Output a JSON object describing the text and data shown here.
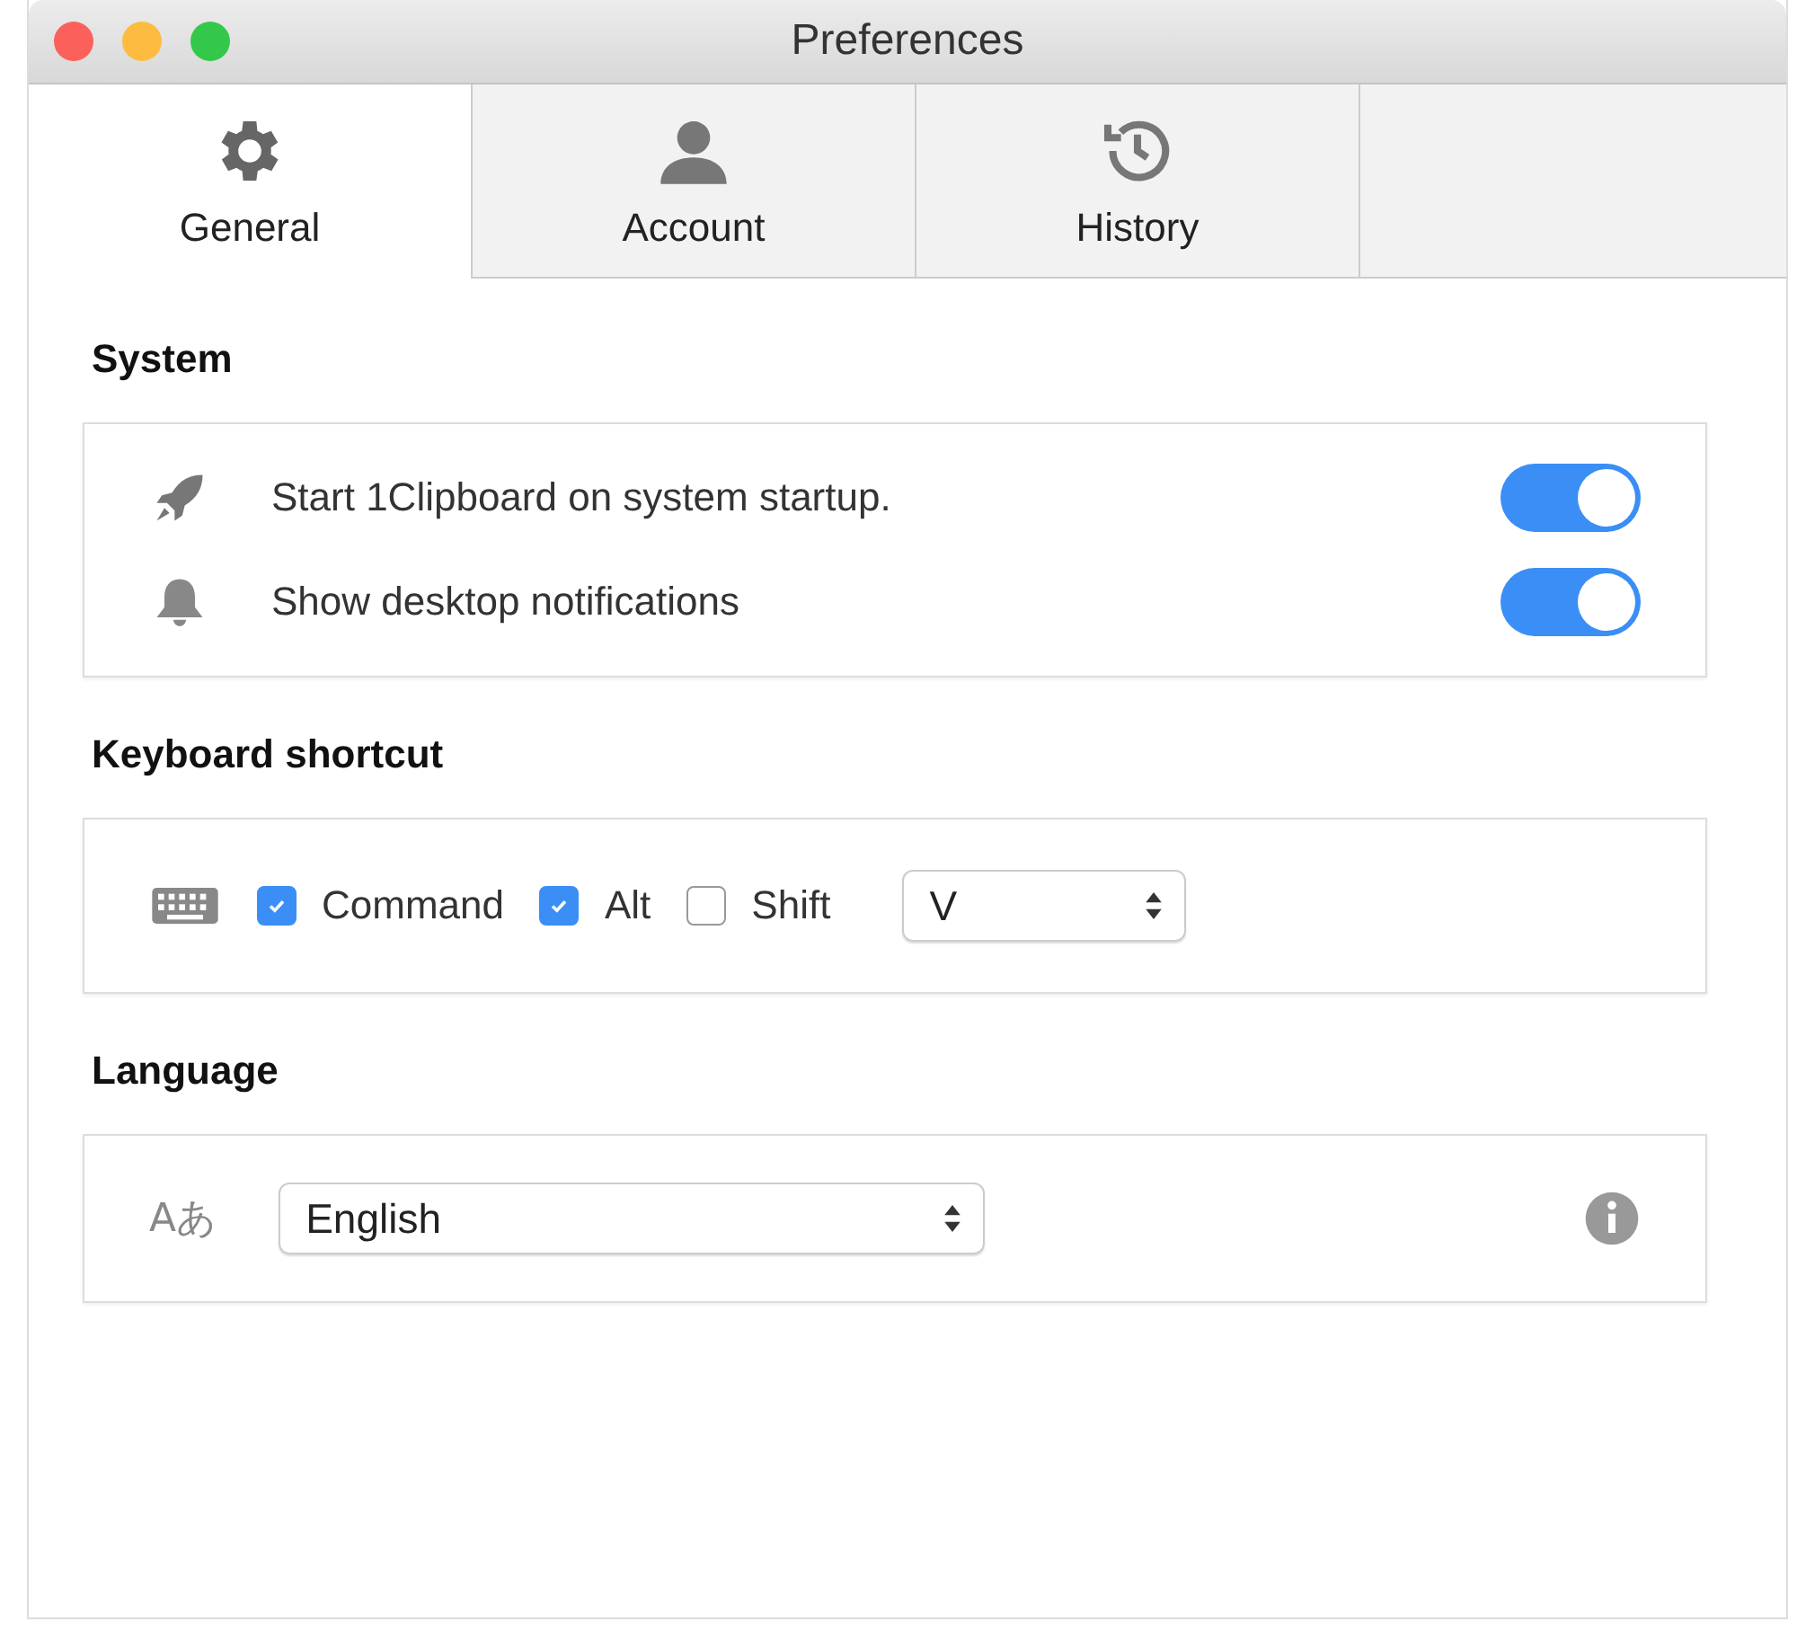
{
  "window": {
    "title": "Preferences"
  },
  "tabs": [
    {
      "label": "General",
      "kind": "gear",
      "selected": true
    },
    {
      "label": "Account",
      "kind": "person",
      "selected": false
    },
    {
      "label": "History",
      "kind": "history",
      "selected": false
    }
  ],
  "system": {
    "heading": "System",
    "rows": [
      {
        "label": "Start 1Clipboard on system startup.",
        "kind": "rocket",
        "on": true
      },
      {
        "label": "Show desktop notifications",
        "kind": "bell",
        "on": true
      }
    ]
  },
  "keyboard": {
    "heading": "Keyboard shortcut",
    "modifiers": [
      {
        "label": "Command",
        "checked": true
      },
      {
        "label": "Alt",
        "checked": true
      },
      {
        "label": "Shift",
        "checked": false
      }
    ],
    "key": {
      "value": "V"
    }
  },
  "language": {
    "heading": "Language",
    "icon": "Aあ",
    "select": {
      "value": "English"
    }
  }
}
